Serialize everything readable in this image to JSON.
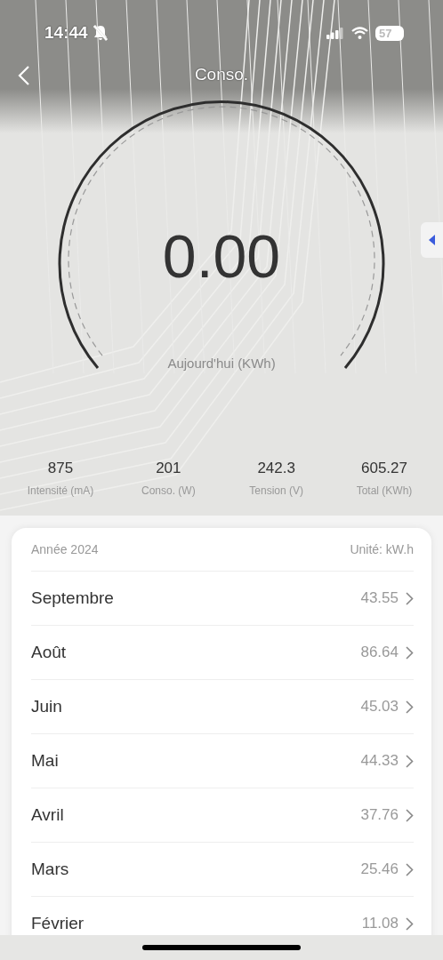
{
  "status_bar": {
    "time": "14:44",
    "battery": "57"
  },
  "nav": {
    "title": "Conso."
  },
  "gauge": {
    "value": "0.00",
    "label": "Aujourd'hui (KWh)"
  },
  "stats": [
    {
      "value": "875",
      "label": "Intensité (mA)"
    },
    {
      "value": "201",
      "label": "Conso. (W)"
    },
    {
      "value": "242.3",
      "label": "Tension (V)"
    },
    {
      "value": "605.27",
      "label": "Total (KWh)"
    }
  ],
  "card": {
    "year": "Année 2024",
    "unit": "Unité: kW.h",
    "months": [
      {
        "name": "Septembre",
        "value": "43.55"
      },
      {
        "name": "Août",
        "value": "86.64"
      },
      {
        "name": "Juin",
        "value": "45.03"
      },
      {
        "name": "Mai",
        "value": "44.33"
      },
      {
        "name": "Avril",
        "value": "37.76"
      },
      {
        "name": "Mars",
        "value": "25.46"
      },
      {
        "name": "Février",
        "value": "11.08"
      }
    ]
  }
}
